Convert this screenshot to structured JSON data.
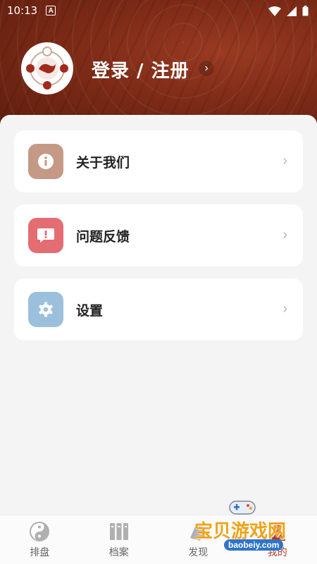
{
  "status_bar": {
    "time": "10:13",
    "notif_letter": "A"
  },
  "header": {
    "login_label": "登录 / 注册",
    "chevron": "›"
  },
  "menu": [
    {
      "label": "关于我们",
      "icon": "info-icon",
      "color": "#c49a87"
    },
    {
      "label": "问题反馈",
      "icon": "feedback-icon",
      "color": "#e36d73"
    },
    {
      "label": "设置",
      "icon": "gear-icon",
      "color": "#9cc0dc"
    }
  ],
  "menu_chevron": "›",
  "tabs": [
    {
      "label": "排盘",
      "icon": "yin-yang-icon"
    },
    {
      "label": "档案",
      "icon": "archive-icon"
    },
    {
      "label": "发现",
      "icon": "discover-icon"
    },
    {
      "label": "我的",
      "icon": "profile-icon",
      "active": true
    }
  ],
  "watermark": {
    "text": "宝贝游戏网",
    "url": "baobeiy.com"
  },
  "colors": {
    "header": "#7e2b17",
    "accent": "#b33a2a"
  }
}
